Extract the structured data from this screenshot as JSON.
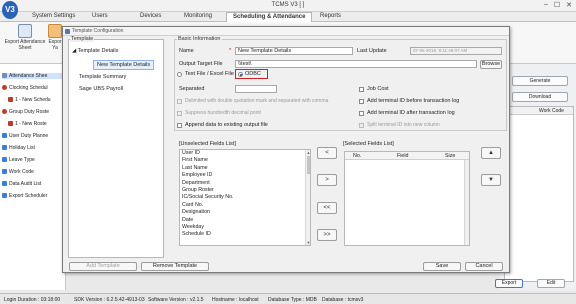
{
  "app": {
    "title": "TCMS V3 [ ]",
    "logo_text": "V3",
    "window_buttons": [
      "–",
      "☐",
      "✕"
    ]
  },
  "menu": [
    {
      "label": "System Settings"
    },
    {
      "label": "Users"
    },
    {
      "label": "Devices"
    },
    {
      "label": "Monitoring"
    },
    {
      "label": "Scheduling & Attendance",
      "active": true
    },
    {
      "label": "Reports"
    }
  ],
  "ribbon": {
    "export_attendance_sheet": "Export Attendance Sheet",
    "export_short": "Expor Ya"
  },
  "left_panel": {
    "items": [
      {
        "label": "Attendance Shee",
        "selected": true
      },
      {
        "label": "Clocking Schedul"
      },
      {
        "label": "1 - New Schedu"
      },
      {
        "label": "Group Duty Roste"
      },
      {
        "label": "1 - New Roste"
      },
      {
        "label": "User Duty Planne"
      },
      {
        "label": "Holiday List"
      },
      {
        "label": "Leave Type"
      },
      {
        "label": "Work Code"
      },
      {
        "label": "Data Audit List"
      },
      {
        "label": "Export Scheduler"
      }
    ]
  },
  "right_panel": {
    "generate": "Generate",
    "download": "Download",
    "work_code_col": "Work Code",
    "export": "Export",
    "edit": "Edit"
  },
  "dialog": {
    "title": "Template Configuration",
    "template_group": "Template",
    "tree": {
      "template_details": "Template Details",
      "new_template_details": "New Template Details",
      "template_summary": "Template Summary",
      "sage_ubs_payroll": "Sage UBS Payroll"
    },
    "basic_info_group": "Basic Information",
    "name_label": "Name",
    "name_value": "New Template Details",
    "last_update_label": "Last Update",
    "last_update_value": "07-05-2018, 9:11:48:07 AM",
    "output_target_label": "Output Target File",
    "output_target_value": "\\\\test\\",
    "browse": "Browse",
    "radio_text_file": "Text File / Excel File",
    "radio_odbc": "ODBC",
    "separated_label": "Separated",
    "job_cost": "Job Cost",
    "delimited_option": "Delimited with double quotation mark and separated with comma",
    "add_terminal_before": "Add terminal ID before transaction log",
    "suppress_decimal": "Suppress hundredth decimal point",
    "add_terminal_after": "Add terminal ID after transaction log",
    "append_data": "Append data to existing output file",
    "split_terminal": "Split terminal ID into new column",
    "unselected_label": "[Unselected Fields List]",
    "unselected_fields": [
      "User ID",
      "First Name",
      "Last Name",
      "Employee ID",
      "Department",
      "Group Roster",
      "IC/Social Security No.",
      "Card No.",
      "Designation",
      "Date",
      "Weekday",
      "Schedule ID"
    ],
    "selected_label": "[Selected Fields List]",
    "selected_cols": {
      "no": "No.",
      "field": "Field",
      "size": "Size"
    },
    "arrows": {
      "add": "<",
      "remove": ">",
      "add_all": "<<",
      "remove_all": ">>",
      "up": "▲",
      "down": "▼"
    },
    "add_template": "Add Template",
    "remove_template": "Remove Template",
    "save": "Save",
    "cancel": "Cancel"
  },
  "status": {
    "login_duration": "Login Duration : 03:18:00",
    "sdk_version": "SDK Version : 6.2.5.42-4913-03",
    "software_version": "Software Version : v2.1.5",
    "hostname": "Hostname : localhost",
    "database_type": "Database Type : MDB",
    "database": "Database : tcmsv3"
  },
  "colors": {
    "accent": "#2a62b8",
    "highlight_red": "#d0201f",
    "selection": "#cfe3fb"
  }
}
